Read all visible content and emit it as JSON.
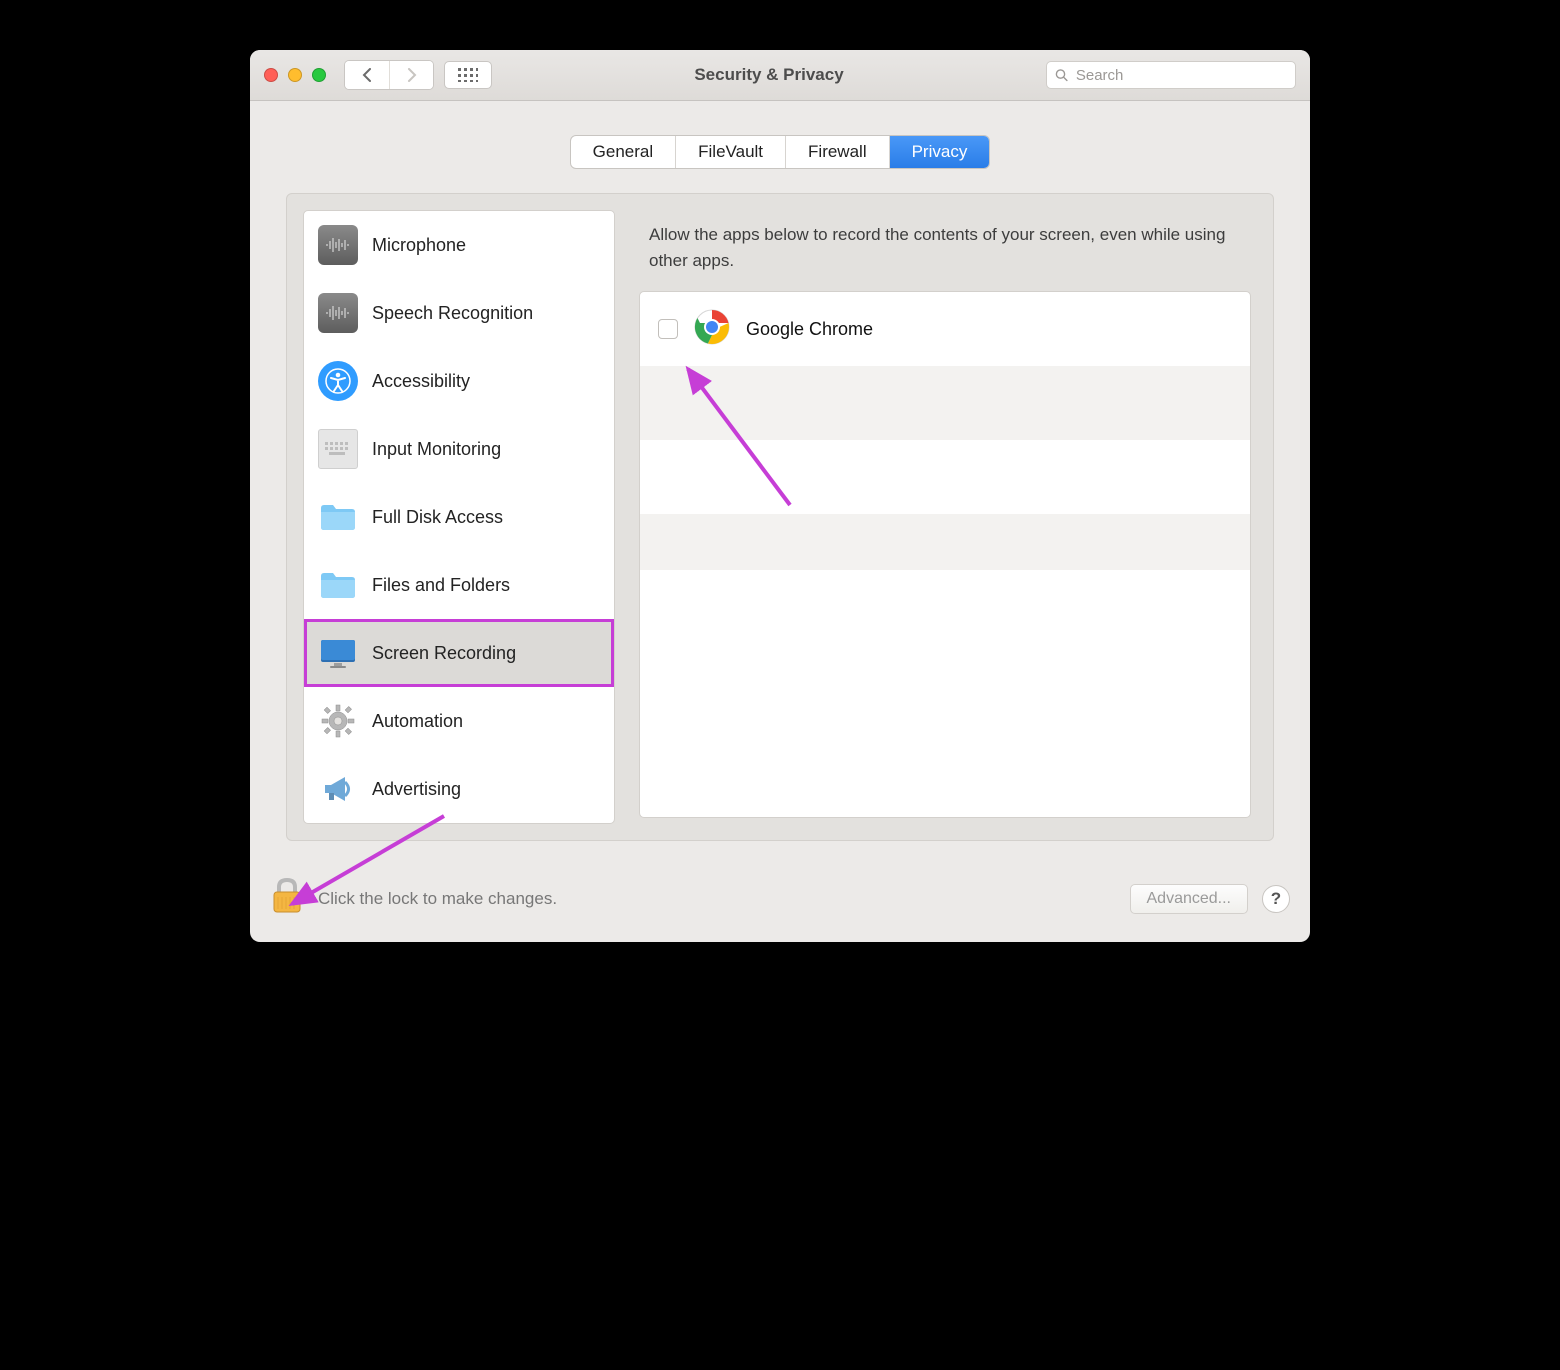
{
  "window": {
    "title": "Security & Privacy",
    "search_placeholder": "Search"
  },
  "tabs": [
    {
      "label": "General",
      "active": false
    },
    {
      "label": "FileVault",
      "active": false
    },
    {
      "label": "Firewall",
      "active": false
    },
    {
      "label": "Privacy",
      "active": true
    }
  ],
  "description": "Allow the apps below to record the contents of your screen, even while using other apps.",
  "sidebar": {
    "items": [
      {
        "label": "Microphone",
        "icon": "microphone-icon",
        "selected": false
      },
      {
        "label": "Speech Recognition",
        "icon": "speech-icon",
        "selected": false
      },
      {
        "label": "Accessibility",
        "icon": "accessibility-icon",
        "selected": false
      },
      {
        "label": "Input Monitoring",
        "icon": "keyboard-icon",
        "selected": false
      },
      {
        "label": "Full Disk Access",
        "icon": "folder-icon",
        "selected": false
      },
      {
        "label": "Files and Folders",
        "icon": "folder-icon",
        "selected": false
      },
      {
        "label": "Screen Recording",
        "icon": "monitor-icon",
        "selected": true
      },
      {
        "label": "Automation",
        "icon": "gear-icon",
        "selected": false
      },
      {
        "label": "Advertising",
        "icon": "megaphone-icon",
        "selected": false
      }
    ]
  },
  "apps": [
    {
      "name": "Google Chrome",
      "checked": false
    }
  ],
  "footer": {
    "lock_text": "Click the lock to make changes.",
    "advanced_label": "Advanced...",
    "help_label": "?"
  },
  "colors": {
    "accent": "#2a7de8",
    "annotation": "#c63ed6"
  }
}
